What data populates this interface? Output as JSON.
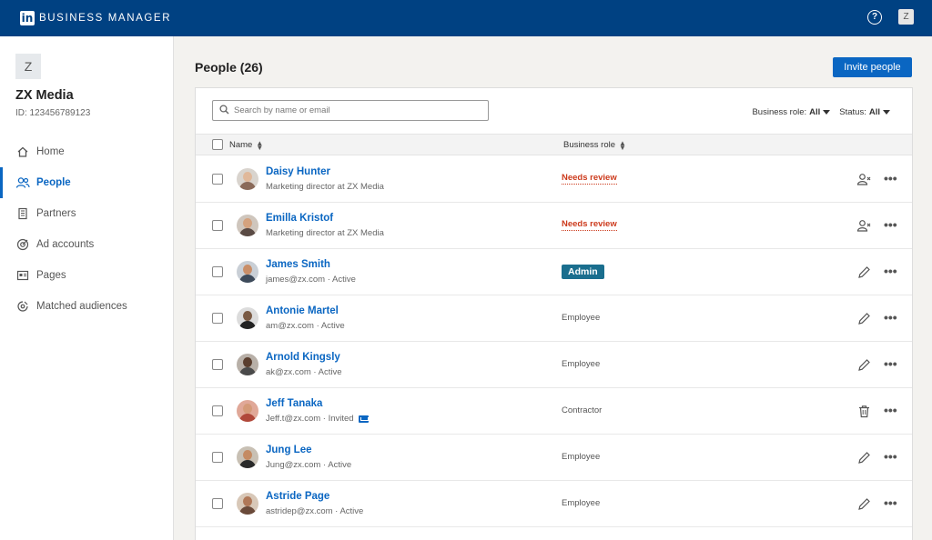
{
  "header": {
    "logo_text": "in",
    "title": "BUSINESS MANAGER",
    "avatar_letter": "Z"
  },
  "sidebar": {
    "org_initial": "Z",
    "org_name": "ZX Media",
    "org_id": "ID: 123456789123",
    "items": [
      {
        "label": "Home",
        "icon": "home-icon",
        "active": false
      },
      {
        "label": "People",
        "icon": "people-icon",
        "active": true
      },
      {
        "label": "Partners",
        "icon": "building-icon",
        "active": false
      },
      {
        "label": "Ad accounts",
        "icon": "target-icon",
        "active": false
      },
      {
        "label": "Pages",
        "icon": "page-icon",
        "active": false
      },
      {
        "label": "Matched audiences",
        "icon": "audience-icon",
        "active": false
      }
    ]
  },
  "main": {
    "title": "People (26)",
    "invite_label": "Invite people",
    "search_placeholder": "Search by name or email",
    "filters": {
      "role_label": "Business role:",
      "role_value": "All",
      "status_label": "Status:",
      "status_value": "All"
    },
    "columns": {
      "name": "Name",
      "role": "Business role"
    },
    "rows": [
      {
        "name": "Daisy Hunter",
        "sub": "Marketing director at ZX Media",
        "role": "Needs review",
        "role_style": "review",
        "action": "remove-user-icon"
      },
      {
        "name": "Emilla Kristof",
        "sub": "Marketing director at ZX Media",
        "role": "Needs review",
        "role_style": "review",
        "action": "remove-user-icon"
      },
      {
        "name": "James Smith",
        "sub": "james@zx.com · Active",
        "role": "Admin",
        "role_style": "badge",
        "action": "pencil-icon"
      },
      {
        "name": "Antonie Martel",
        "sub": "am@zx.com · Active",
        "role": "Employee",
        "role_style": "plain",
        "action": "pencil-icon"
      },
      {
        "name": "Arnold Kingsly",
        "sub": "ak@zx.com · Active",
        "role": "Employee",
        "role_style": "plain",
        "action": "pencil-icon"
      },
      {
        "name": "Jeff Tanaka",
        "sub": "Jeff.t@zx.com · Invited",
        "role": "Contractor",
        "role_style": "plain",
        "action": "trash-icon",
        "mail": true
      },
      {
        "name": "Jung Lee",
        "sub": "Jung@zx.com · Active",
        "role": "Employee",
        "role_style": "plain",
        "action": "pencil-icon"
      },
      {
        "name": "Astride Page",
        "sub": "astridep@zx.com · Active",
        "role": "Employee",
        "role_style": "plain",
        "action": "pencil-icon"
      }
    ]
  },
  "colors": {
    "topbar": "#004182",
    "accent": "#0a66c2",
    "review": "#cc3a1c",
    "admin_badge": "#1a6e8e"
  }
}
